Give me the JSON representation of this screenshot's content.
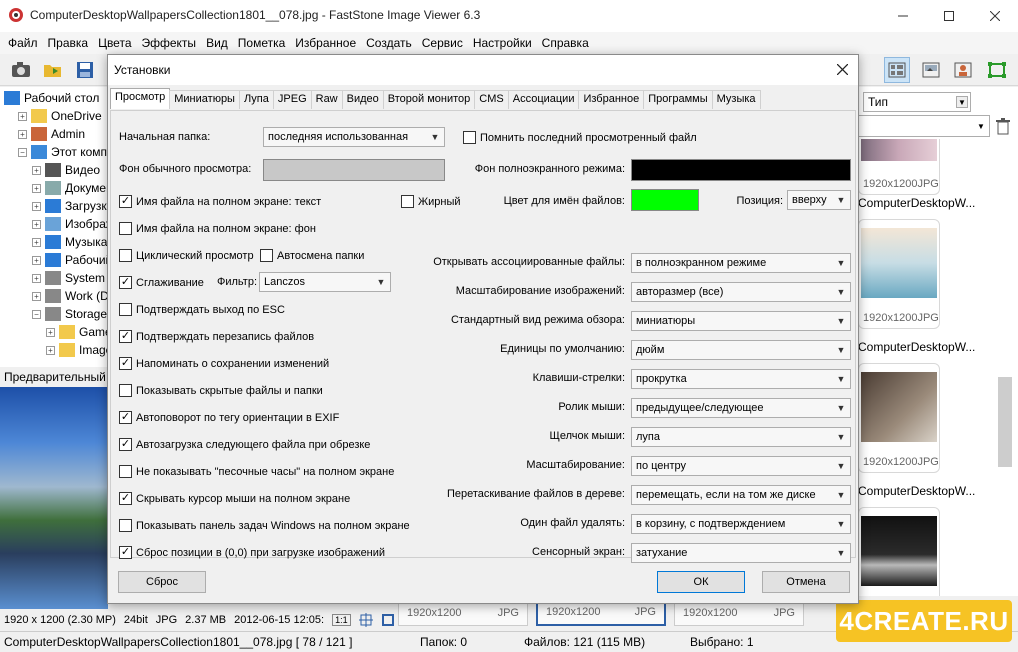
{
  "window": {
    "title": "ComputerDesktopWallpapersCollection1801__078.jpg - FastStone Image Viewer 6.3"
  },
  "menu": [
    "Файл",
    "Правка",
    "Цвета",
    "Эффекты",
    "Вид",
    "Пометка",
    "Избранное",
    "Создать",
    "Сервис",
    "Настройки",
    "Справка"
  ],
  "tree": [
    {
      "label": "Рабочий стол",
      "icon": "desktop-icon",
      "depth": 0,
      "exp": ""
    },
    {
      "label": "OneDrive",
      "icon": "folder-icon",
      "depth": 1,
      "exp": "+"
    },
    {
      "label": "Admin",
      "icon": "user-icon",
      "depth": 1,
      "exp": "+"
    },
    {
      "label": "Этот компьютер",
      "icon": "computer-icon",
      "depth": 1,
      "exp": "−"
    },
    {
      "label": "Видео",
      "icon": "video-folder-icon",
      "depth": 2,
      "exp": "+"
    },
    {
      "label": "Документы",
      "icon": "documents-folder-icon",
      "depth": 2,
      "exp": "+"
    },
    {
      "label": "Загрузки",
      "icon": "downloads-folder-icon",
      "depth": 2,
      "exp": "+"
    },
    {
      "label": "Изображения",
      "icon": "pictures-folder-icon",
      "depth": 2,
      "exp": "+"
    },
    {
      "label": "Музыка",
      "icon": "music-folder-icon",
      "depth": 2,
      "exp": "+"
    },
    {
      "label": "Рабочий стол",
      "icon": "desktop-folder-icon",
      "depth": 2,
      "exp": "+"
    },
    {
      "label": "System (C:)",
      "icon": "drive-icon",
      "depth": 2,
      "exp": "+"
    },
    {
      "label": "Work (D:)",
      "icon": "drive-icon",
      "depth": 2,
      "exp": "+"
    },
    {
      "label": "Storage",
      "icon": "drive-icon",
      "depth": 2,
      "exp": "−"
    },
    {
      "label": "Games",
      "icon": "folder-icon",
      "depth": 3,
      "exp": "+"
    },
    {
      "label": "Images",
      "icon": "folder-icon",
      "depth": 3,
      "exp": "+"
    }
  ],
  "preview_label": "Предварительный просмотр",
  "right_panel": {
    "sort_label": "Тип",
    "thumb_meta": {
      "size": "1920x1200",
      "type": "JPG"
    },
    "file_names": [
      "ComputerDesktopW...",
      "ComputerDesktopW...",
      "ComputerDesktopW..."
    ]
  },
  "status_image": {
    "dims": "1920 x 1200 (2.30 MP)",
    "bits": "24bit",
    "fmt": "JPG",
    "size": "2.37 MB",
    "date": "2012-06-15 12:05:",
    "zoom": "1:1"
  },
  "bottom_strip": {
    "size": "1920x1200",
    "type": "JPG"
  },
  "status_bar": {
    "file": "ComputerDesktopWallpapersCollection1801__078.jpg [ 78 / 121 ]",
    "folders": "Папок: 0",
    "files": "Файлов: 121 (115 MB)",
    "selected": "Выбрано: 1"
  },
  "logo": "4CREATE.RU",
  "dialog": {
    "title": "Установки",
    "tabs": [
      "Просмотр",
      "Миниатюры",
      "Лупа",
      "JPEG",
      "Raw",
      "Видео",
      "Второй монитор",
      "CMS",
      "Ассоциации",
      "Избранное",
      "Программы",
      "Музыка"
    ],
    "start_folder_label": "Начальная папка:",
    "start_folder_value": "последняя использованная",
    "remember_last_file": "Помнить последний просмотренный файл",
    "normal_bg_label": "Фон обычного просмотра:",
    "fullscreen_bg_label": "Фон полноэкранного режима:",
    "fullscreen_bg_color": "#000000",
    "normal_bg_color": "#c8c8c8",
    "checkboxes": [
      {
        "label": "Имя файла на полном экране: текст",
        "checked": true
      },
      {
        "label": "Имя файла на полном экране: фон",
        "checked": false
      },
      {
        "label": "Циклический просмотр",
        "checked": false
      },
      {
        "label": "Сглаживание",
        "checked": true
      },
      {
        "label": "Подтверждать выход по ESC",
        "checked": false
      },
      {
        "label": "Подтверждать перезапись файлов",
        "checked": true
      },
      {
        "label": "Напоминать о сохранении изменений",
        "checked": true
      },
      {
        "label": "Показывать скрытые файлы и папки",
        "checked": false
      },
      {
        "label": "Автоповорот по тегу ориентации в EXIF",
        "checked": true
      },
      {
        "label": "Автозагрузка следующего файла при обрезке",
        "checked": true
      },
      {
        "label": "Не показывать \"песочные часы\" на полном экране",
        "checked": false
      },
      {
        "label": "Скрывать курсор мыши на полном экране",
        "checked": true
      },
      {
        "label": "Показывать панель задач Windows на полном экране",
        "checked": false
      },
      {
        "label": "Сброс позиции в (0,0) при загрузке изображений",
        "checked": true
      }
    ],
    "bold_label": "Жирный",
    "autochange_folder": "Автосмена папки",
    "filter_label": "Фильтр:",
    "filter_value": "Lanczos",
    "filename_color_label": "Цвет для имён файлов:",
    "filename_color": "#00ff00",
    "position_label": "Позиция:",
    "position_value": "вверху",
    "settings": [
      {
        "label": "Открывать ассоциированные файлы:",
        "value": "в полноэкранном режиме"
      },
      {
        "label": "Масштабирование изображений:",
        "value": "авторазмер (все)"
      },
      {
        "label": "Стандартный вид режима обзора:",
        "value": "миниатюры"
      },
      {
        "label": "Единицы по умолчанию:",
        "value": "дюйм"
      },
      {
        "label": "Клавиши-стрелки:",
        "value": "прокрутка"
      },
      {
        "label": "Ролик мыши:",
        "value": "предыдущее/следующее"
      },
      {
        "label": "Щелчок мыши:",
        "value": "лупа"
      },
      {
        "label": "Масштабирование:",
        "value": "по центру"
      },
      {
        "label": "Перетаскивание файлов в дереве:",
        "value": "перемещать, если на том же диске"
      },
      {
        "label": "Один файл удалять:",
        "value": "в корзину, с подтверждением"
      },
      {
        "label": "Сенсорный экран:",
        "value": "затухание"
      }
    ],
    "reset_button": "Сброс",
    "ok_button": "ОК",
    "cancel_button": "Отмена"
  }
}
